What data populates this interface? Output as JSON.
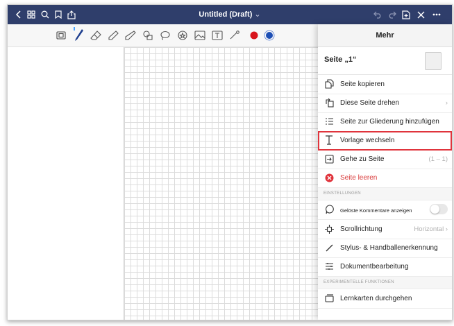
{
  "header": {
    "doc_title": "Untitled (Draft)",
    "title_caret": "⌄",
    "back_icon": "chevron-left-icon",
    "grid_icon": "grid-icon",
    "search_icon": "search-icon",
    "bookmark_icon": "bookmark-icon",
    "share_icon": "share-icon",
    "undo_icon": "undo-icon",
    "redo_icon": "redo-icon",
    "add_page_icon": "add-page-icon",
    "close_icon": "close-icon",
    "more_icon": "more-icon"
  },
  "toolbar": {
    "tools": [
      "page-layout-icon",
      "pen-icon",
      "eraser-icon",
      "highlighter-icon",
      "shapes-icon",
      "lasso-icon",
      "sticker-icon",
      "image-icon",
      "text-icon",
      "laser-pointer-icon"
    ],
    "colors": [
      "#d8141c",
      "#1d4fb5"
    ]
  },
  "panel": {
    "title": "Mehr",
    "page_label": "Seite „1“",
    "items": [
      {
        "label": "Seite kopieren",
        "icon": "copy-page-icon"
      },
      {
        "label": "Diese Seite drehen",
        "icon": "rotate-page-icon",
        "chevron": "›"
      },
      {
        "label": "Seite zur Gliederung hinzufügen",
        "icon": "outline-list-icon"
      },
      {
        "label": "Vorlage wechseln",
        "icon": "template-icon",
        "highlighted": true
      },
      {
        "label": "Gehe zu Seite",
        "icon": "go-to-page-icon",
        "value": "(1 – 1)"
      },
      {
        "label": "Seite leeren",
        "icon": "clear-page-icon",
        "danger": true
      }
    ],
    "settings_header": "EINSTELLUNGEN",
    "settings": [
      {
        "label": "Gelöste Kommentare anzeigen",
        "icon": "comment-icon",
        "toggle": false
      },
      {
        "label": "Scrollrichtung",
        "icon": "scroll-direction-icon",
        "value": "Horizontal ›"
      },
      {
        "label": "Stylus- & Handballenerkennung",
        "icon": "stylus-icon"
      },
      {
        "label": "Dokumentbearbeitung",
        "icon": "edit-document-icon"
      }
    ],
    "experimental_header": "EXPERIMENTELLE FUNKTIONEN",
    "experimental": [
      {
        "label": "Lernkarten durchgehen",
        "icon": "flashcards-icon"
      }
    ]
  }
}
